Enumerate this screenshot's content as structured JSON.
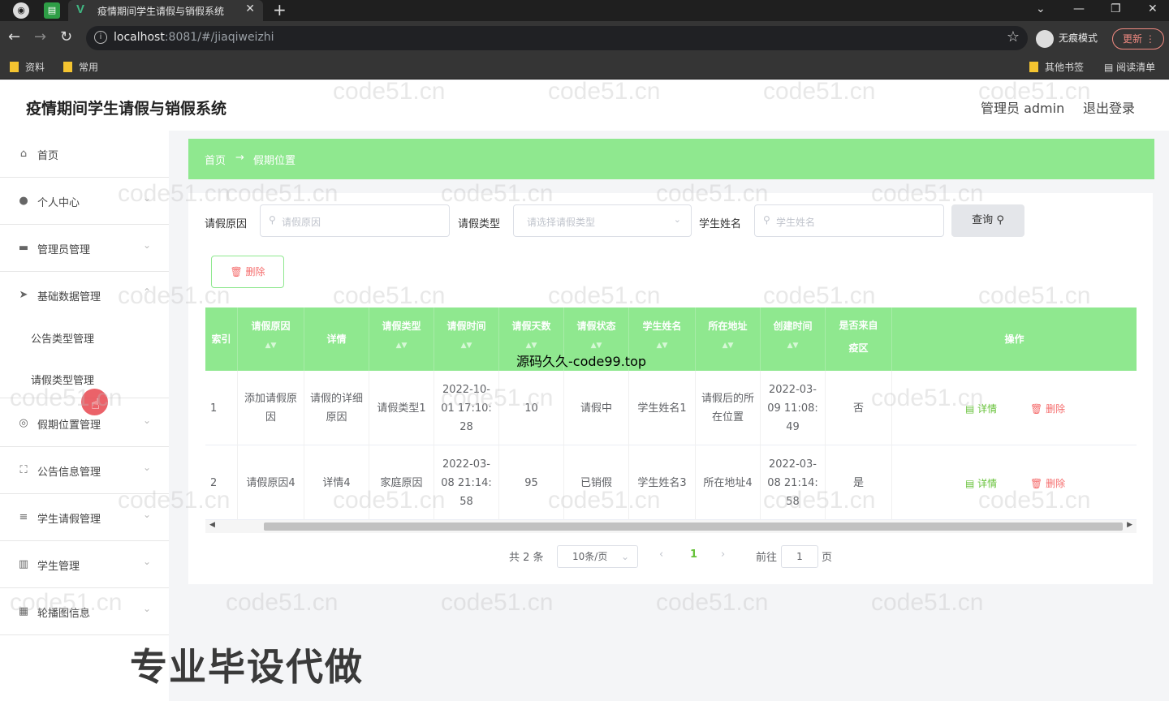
{
  "browser": {
    "tab_title": "疫情期间学生请假与销假系统",
    "url_host": "localhost",
    "url_rest": ":8081/#/jiaqiweizhi",
    "incognito_label": "无痕模式",
    "update_label": "更新",
    "bookmarks": [
      "资料",
      "常用",
      "其他书签",
      "阅读清单"
    ]
  },
  "app": {
    "title": "疫情期间学生请假与销假系统",
    "user": "管理员 admin",
    "logout": "退出登录"
  },
  "sidebar": {
    "items": [
      {
        "label": "首页",
        "icon": "home-icon"
      },
      {
        "label": "个人中心",
        "icon": "user-icon"
      },
      {
        "label": "管理员管理",
        "icon": "admin-icon"
      },
      {
        "label": "基础数据管理",
        "icon": "send-icon"
      },
      {
        "label": "假期位置管理",
        "icon": "location-icon"
      },
      {
        "label": "公告信息管理",
        "icon": "fullscreen-icon"
      },
      {
        "label": "学生请假管理",
        "icon": "filter-icon"
      },
      {
        "label": "学生管理",
        "icon": "chart-icon"
      },
      {
        "label": "轮播图信息",
        "icon": "image-icon"
      }
    ],
    "subitems": [
      "公告类型管理",
      "请假类型管理"
    ]
  },
  "breadcrumb": {
    "home": "首页",
    "arrow": "→",
    "current": "假期位置"
  },
  "filters": {
    "reason_label": "请假原因",
    "reason_placeholder": "请假原因",
    "type_label": "请假类型",
    "type_placeholder": "请选择请假类型",
    "name_label": "学生姓名",
    "name_placeholder": "学生姓名",
    "query_button": "查询",
    "delete_button": "删除"
  },
  "table": {
    "headers": [
      "索引",
      "请假原因",
      "详情",
      "请假类型",
      "请假时间",
      "请假天数",
      "请假状态",
      "学生姓名",
      "所在地址",
      "创建时间",
      "是否来自疫区",
      "操作"
    ],
    "rows": [
      [
        "1",
        "添加请假原因",
        "请假的详细原因",
        "请假类型1",
        "2022-10-01 17:10:28",
        "10",
        "请假中",
        "学生姓名1",
        "请假后的所在位置",
        "2022-03-09 11:08:49",
        "否"
      ],
      [
        "2",
        "请假原因4",
        "详情4",
        "家庭原因",
        "2022-03-08 21:14:58",
        "95",
        "已销假",
        "学生姓名3",
        "所在地址4",
        "2022-03-08 21:14:58",
        "是"
      ]
    ],
    "detail_label": "详情",
    "delete_label": "删除"
  },
  "pagination": {
    "total": "共 2 条",
    "page_size": "10条/页",
    "current_page": "1",
    "goto_label": "前往",
    "goto_value": "1",
    "page_unit": "页"
  },
  "overlay": {
    "watermark": "code51.cn",
    "center_text": "源码久久-code99.top",
    "promo": "专业毕设代做"
  }
}
